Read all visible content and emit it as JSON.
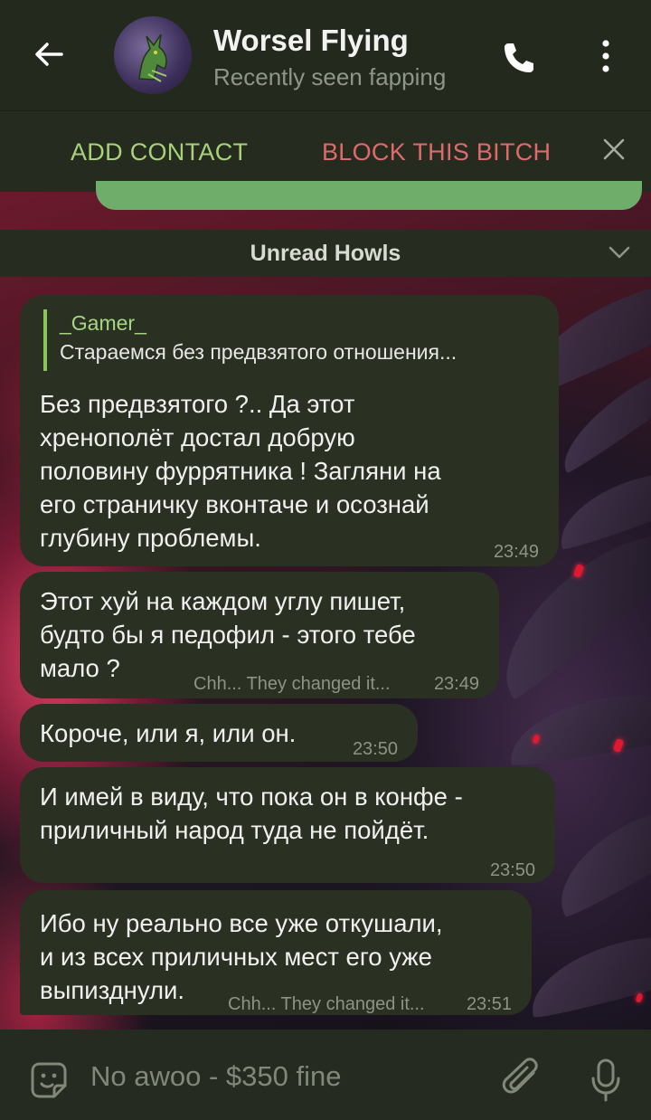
{
  "header": {
    "title": "Worsel Flying",
    "status": "Recently seen fapping"
  },
  "actionbar": {
    "add_contact": "ADD CONTACT",
    "block": "BLOCK THIS BITCH"
  },
  "unread": {
    "label": "Unread Howls"
  },
  "messages": [
    {
      "reply_name": "_Gamer_",
      "reply_text": "Стараемся без предвзятого отношения...",
      "lines": [
        "Без предвзятого ?.. Да этот",
        "хренополёт достал добрую",
        "половину фуррятника ! Загляни на",
        "его страничку вконтаче и осознай",
        "глубину проблемы."
      ],
      "time": "23:49"
    },
    {
      "lines": [
        "Этот хуй на каждом углу пишет,",
        "будто бы я педофил - этого тебе",
        "мало ?"
      ],
      "edited": "Chh... They changed it...",
      "time": "23:49"
    },
    {
      "lines": [
        "Короче, или я, или он."
      ],
      "time": "23:50"
    },
    {
      "lines": [
        "И имей в виду, что пока он в конфе -",
        "приличный народ туда не пойдёт."
      ],
      "time": "23:50"
    },
    {
      "lines": [
        "Ибо ну реально все уже откушали,",
        "и из всех приличных мест его уже",
        "выпизднули."
      ],
      "edited": "Chh... They changed it...",
      "time": "23:51"
    }
  ],
  "input": {
    "placeholder": "No awoo - $350 fine"
  },
  "colors": {
    "accent_green": "#a8d27a",
    "danger_red": "#e06a6a",
    "bubble_bg": "#2a3022"
  }
}
